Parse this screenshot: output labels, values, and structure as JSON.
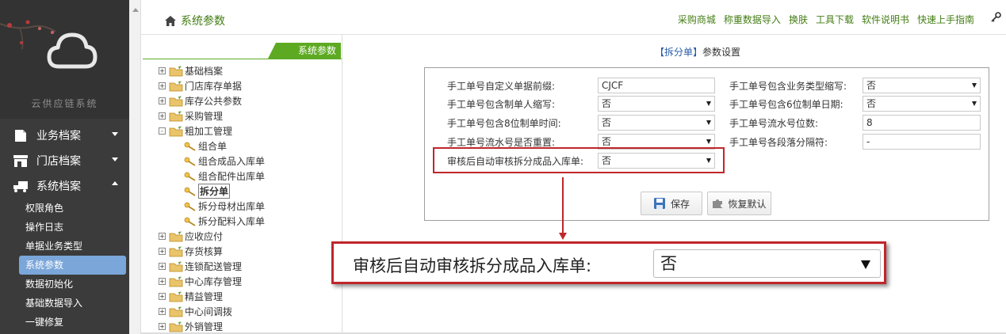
{
  "sidebar": {
    "system_name": "云供应链系统",
    "nav": [
      {
        "label": "业务档案",
        "icon": "file-icon",
        "expanded": false
      },
      {
        "label": "门店档案",
        "icon": "store-icon",
        "expanded": false
      },
      {
        "label": "系统档案",
        "icon": "truck-icon",
        "expanded": true
      }
    ],
    "sub_items": [
      "权限角色",
      "操作日志",
      "单据业务类型",
      "系统参数",
      "数据初始化",
      "基础数据导入",
      "一键修复"
    ],
    "active_sub": "系统参数"
  },
  "header": {
    "title": "系统参数",
    "links": [
      "采购商城",
      "称重数据导入",
      "换肤",
      "工具下载",
      "软件说明书",
      "快速上手指南"
    ]
  },
  "tree": {
    "tab_label": "系统参数",
    "nodes": [
      {
        "label": "基础档案",
        "type": "folder",
        "sign": "+"
      },
      {
        "label": "门店库存单据",
        "type": "folder",
        "sign": "+"
      },
      {
        "label": "库存公共参数",
        "type": "folder",
        "sign": "+"
      },
      {
        "label": "采购管理",
        "type": "folder",
        "sign": "+"
      },
      {
        "label": "粗加工管理",
        "type": "folder",
        "sign": "-"
      },
      {
        "label": "组合单",
        "type": "leaf"
      },
      {
        "label": "组合成品入库单",
        "type": "leaf"
      },
      {
        "label": "组合配件出库单",
        "type": "leaf"
      },
      {
        "label": "拆分单",
        "type": "leaf",
        "selected": true
      },
      {
        "label": "拆分母材出库单",
        "type": "leaf"
      },
      {
        "label": "拆分配料入库单",
        "type": "leaf"
      },
      {
        "label": "应收应付",
        "type": "folder",
        "sign": "+"
      },
      {
        "label": "存货核算",
        "type": "folder",
        "sign": "+"
      },
      {
        "label": "连锁配送管理",
        "type": "folder",
        "sign": "+"
      },
      {
        "label": "中心库存管理",
        "type": "folder",
        "sign": "+"
      },
      {
        "label": "精益管理",
        "type": "folder",
        "sign": "+"
      },
      {
        "label": "中心间调拨",
        "type": "folder",
        "sign": "+"
      },
      {
        "label": "外销管理",
        "type": "folder",
        "sign": "+"
      }
    ]
  },
  "main": {
    "title_highlight": "【拆分单】",
    "title_rest": "参数设置",
    "fields": {
      "f1": {
        "label": "手工单号自定义单据前缀:",
        "value": "CJCF",
        "kind": "text"
      },
      "f2": {
        "label": "手工单号包含制单人缩写:",
        "value": "否",
        "kind": "select"
      },
      "f3": {
        "label": "手工单号包含8位制单时间:",
        "value": "否",
        "kind": "select"
      },
      "f4": {
        "label": "手工单号流水号是否重置:",
        "value": "否",
        "kind": "select"
      },
      "f5": {
        "label": "审核后自动审核拆分成品入库单:",
        "value": "否",
        "kind": "select"
      },
      "f6": {
        "label": "手工单号包含业务类型缩写:",
        "value": "否",
        "kind": "select"
      },
      "f7": {
        "label": "手工单号包含6位制单日期:",
        "value": "否",
        "kind": "select"
      },
      "f8": {
        "label": "手工单号流水号位数:",
        "value": "8",
        "kind": "text"
      },
      "f9": {
        "label": "手工单号各段落分隔符:",
        "value": "-",
        "kind": "text"
      }
    },
    "save_label": "保存",
    "reset_label": "恢复默认"
  },
  "callout": {
    "label": "审核后自动审核拆分成品入库单:",
    "value": "否"
  },
  "colors": {
    "accent_green": "#5daa22",
    "link_green": "#437d13",
    "highlight_red": "#c0262b",
    "active_blue": "#7aa6d9"
  }
}
